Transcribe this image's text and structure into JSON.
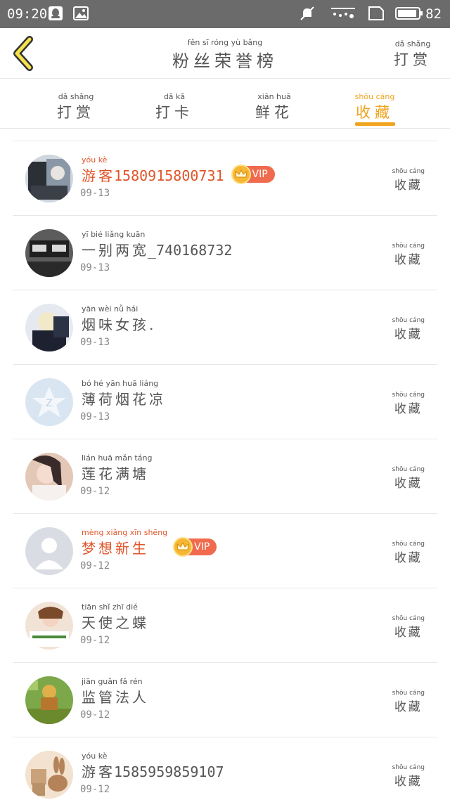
{
  "status_bar": {
    "time": "09:20",
    "battery": "82",
    "icons": [
      "qq-icon",
      "image-icon",
      "mute-icon",
      "bluetooth-icon",
      "sim-icon",
      "battery-icon"
    ]
  },
  "header": {
    "title_pinyin": "fěn  sī  róng  yù  bǎng",
    "title": "粉丝荣誉榜",
    "action_pinyin": "dǎ  shǎng",
    "action": "打赏",
    "back_icon": "chevron-left-icon"
  },
  "tabs": [
    {
      "pinyin": "dǎ  shǎng",
      "label": "打赏"
    },
    {
      "pinyin": "dǎ  kǎ",
      "label": "打卡"
    },
    {
      "pinyin": "xiān  huā",
      "label": "鲜花"
    },
    {
      "pinyin": "shōu  cáng",
      "label": "收藏"
    }
  ],
  "active_tab": "收藏",
  "accent_color": "#f0a31c",
  "vip_label": "VIP",
  "fans": [
    {
      "name_pinyin": "yóu  kè",
      "name": "游客",
      "suffix": "15809158007З1",
      "date": "09-13",
      "vip": true,
      "action_pinyin": "shōu cáng",
      "action": "收藏"
    },
    {
      "name_pinyin": "yī  bié  liǎng kuān",
      "name": "一别两宽",
      "suffix": "_740168732",
      "date": "09-13",
      "vip": false,
      "action_pinyin": "shōu cáng",
      "action": "收藏"
    },
    {
      "name_pinyin": "yān  wèi  nǚ  hái",
      "name": "烟味女孩.",
      "suffix": "",
      "date": "09-13",
      "vip": false,
      "action_pinyin": "shōu cáng",
      "action": "收藏"
    },
    {
      "name_pinyin": "bó  hé  yān  huā liáng",
      "name": "薄荷烟花凉",
      "suffix": "",
      "date": "09-13",
      "vip": false,
      "action_pinyin": "shōu cáng",
      "action": "收藏"
    },
    {
      "name_pinyin": "lián  huā  mǎn  táng",
      "name": "莲花满塘",
      "suffix": "",
      "date": "09-12",
      "vip": false,
      "action_pinyin": "shōu cáng",
      "action": "收藏"
    },
    {
      "name_pinyin": "mèng xiǎng  xīn  shēng",
      "name": "梦想新生",
      "suffix": "",
      "date": "09-12",
      "vip": true,
      "action_pinyin": "shōu cáng",
      "action": "收藏"
    },
    {
      "name_pinyin": "tiān  shǐ  zhī  dié",
      "name": "天使之蝶",
      "suffix": "",
      "date": "09-12",
      "vip": false,
      "action_pinyin": "shōu cáng",
      "action": "收藏"
    },
    {
      "name_pinyin": "jiān  guǎn  fǎ  rén",
      "name": "监管法人",
      "suffix": "",
      "date": "09-12",
      "vip": false,
      "action_pinyin": "shōu cáng",
      "action": "收藏"
    },
    {
      "name_pinyin": "yóu  kè",
      "name": "游客",
      "suffix": "1585959859107",
      "date": "09-12",
      "vip": false,
      "action_pinyin": "shōu cáng",
      "action": "收藏"
    }
  ]
}
